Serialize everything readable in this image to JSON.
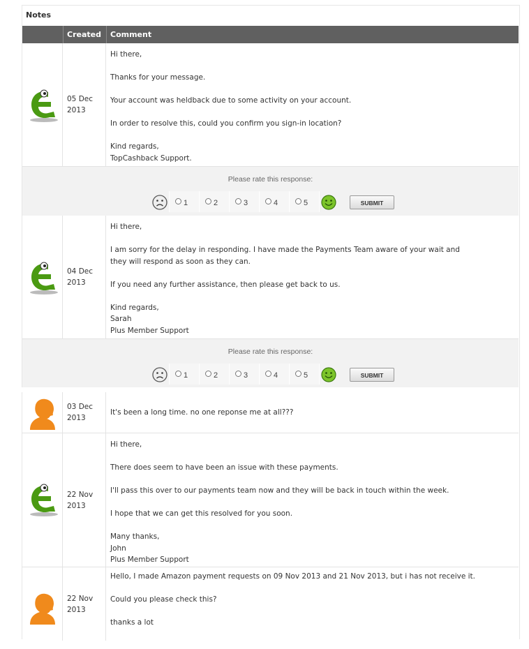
{
  "panel": {
    "title": "Notes"
  },
  "table": {
    "headers": [
      "",
      "Created",
      "Comment"
    ]
  },
  "notes": [
    {
      "author": "support-logo",
      "date": "05 Dec\n2013",
      "paragraphs": [
        "Hi there,",
        "Thanks for your message.",
        "Your account was heldback due to some activity on your account.",
        "In order to resolve this, could you confirm you sign-in location?",
        "Kind regards,\nTopCashback Support."
      ]
    },
    {
      "author": "support-logo",
      "date": "04 Dec\n2013",
      "paragraphs": [
        "Hi there,",
        "I am sorry for the delay in responding. I have made the Payments Team aware of your wait and\nthey will respond as soon as they can.",
        "If you need any further assistance, then please get back to us.",
        "Kind regards,\nSarah\nPlus Member Support"
      ]
    },
    {
      "author": "member-avatar",
      "date": "03 Dec\n2013",
      "paragraphs": [
        "It's been a long time. no one reponse me at all???"
      ]
    },
    {
      "author": "support-logo",
      "date": "22 Nov\n2013",
      "paragraphs": [
        "Hi there,",
        "There does seem to have been an issue with these payments.",
        "I'll pass this over to our payments team now and they will be back in touch within the week.",
        "I hope that we can get this resolved for you soon.",
        "Many thanks,\nJohn\nPlus Member Support"
      ]
    },
    {
      "author": "member-avatar",
      "date": "22 Nov\n2013",
      "paragraphs": [
        "Hello, I made Amazon payment requests on 09 Nov 2013 and 21 Nov 2013, but i has not receive it.",
        "Could you please check this?",
        "thanks a lot"
      ]
    }
  ],
  "rating": {
    "prompt": "Please rate this response:",
    "options": [
      "1",
      "2",
      "3",
      "4",
      "5"
    ],
    "submit_label": "SUBMIT"
  },
  "colors": {
    "header_bg": "#606060",
    "rating_bg": "#f2f2f2",
    "logo_green": "#4a9a12",
    "avatar_orange": "#f08a1c"
  }
}
